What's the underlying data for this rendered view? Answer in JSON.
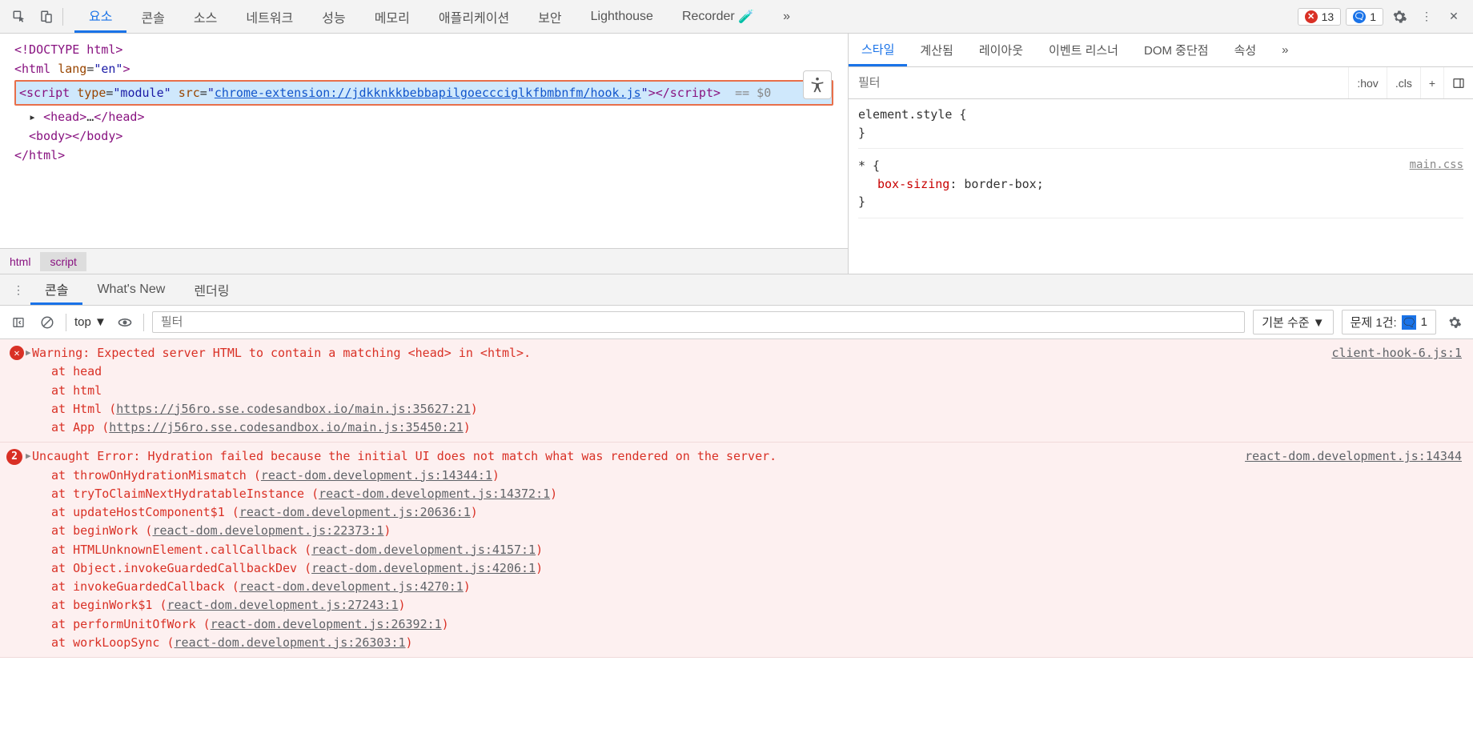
{
  "toolbar": {
    "tabs": [
      "요소",
      "콘솔",
      "소스",
      "네트워크",
      "성능",
      "메모리",
      "애플리케이션",
      "보안",
      "Lighthouse",
      "Recorder"
    ],
    "active_tab": 0,
    "recorder_flask": "⚗",
    "more": "»",
    "error_count": "13",
    "issue_count": "1"
  },
  "dom": {
    "line_doctype": "<!DOCTYPE html>",
    "line_html_open": "<html lang=\"en\">",
    "selected_prefix": "<script type=\"module\" src=\"",
    "selected_link": "chrome-extension://jdkknkkbebbapilgoeccciglkfbmbnfm/hook.js",
    "selected_suffix": "\"></script>",
    "dollar0": "== $0",
    "line_head": "<head>…</head>",
    "line_body": "<body></body>",
    "line_html_close": "</html>"
  },
  "breadcrumb": {
    "items": [
      "html",
      "script"
    ],
    "active": 1
  },
  "styles": {
    "tabs": [
      "스타일",
      "계산됨",
      "레이아웃",
      "이벤트 리스너",
      "DOM 중단점",
      "속성"
    ],
    "active_tab": 0,
    "more": "»",
    "filter_placeholder": "필터",
    "hov": ":hov",
    "cls": ".cls",
    "plus": "+",
    "rule0_selector": "element.style {",
    "rule0_close": "}",
    "rule1_selector": "* {",
    "rule1_prop": "box-sizing",
    "rule1_val": "border-box",
    "rule1_close": "}",
    "rule1_source": "main.css"
  },
  "drawer": {
    "tabs": [
      "콘솔",
      "What's New",
      "렌더링"
    ],
    "active_tab": 0
  },
  "console_toolbar": {
    "context": "top",
    "filter_placeholder": "필터",
    "level": "기본 수준",
    "issues_label": "문제 1건:",
    "issues_count": "1"
  },
  "console": {
    "msg1": {
      "text": "Warning: Expected server HTML to contain a matching <head> in <html>.",
      "source": "client-hook-6.js:1",
      "stack": [
        {
          "at": "at head",
          "link": ""
        },
        {
          "at": "at html",
          "link": ""
        },
        {
          "at": "at Html (",
          "link": "https://j56ro.sse.codesandbox.io/main.js:35627:21",
          "close": ")"
        },
        {
          "at": "at App (",
          "link": "https://j56ro.sse.codesandbox.io/main.js:35450:21",
          "close": ")"
        }
      ]
    },
    "msg2": {
      "count": "2",
      "text": "Uncaught Error: Hydration failed because the initial UI does not match what was rendered on the server.",
      "source": "react-dom.development.js:14344",
      "stack": [
        {
          "at": "at throwOnHydrationMismatch (",
          "link": "react-dom.development.js:14344:1",
          "close": ")"
        },
        {
          "at": "at tryToClaimNextHydratableInstance (",
          "link": "react-dom.development.js:14372:1",
          "close": ")"
        },
        {
          "at": "at updateHostComponent$1 (",
          "link": "react-dom.development.js:20636:1",
          "close": ")"
        },
        {
          "at": "at beginWork (",
          "link": "react-dom.development.js:22373:1",
          "close": ")"
        },
        {
          "at": "at HTMLUnknownElement.callCallback (",
          "link": "react-dom.development.js:4157:1",
          "close": ")"
        },
        {
          "at": "at Object.invokeGuardedCallbackDev (",
          "link": "react-dom.development.js:4206:1",
          "close": ")"
        },
        {
          "at": "at invokeGuardedCallback (",
          "link": "react-dom.development.js:4270:1",
          "close": ")"
        },
        {
          "at": "at beginWork$1 (",
          "link": "react-dom.development.js:27243:1",
          "close": ")"
        },
        {
          "at": "at performUnitOfWork (",
          "link": "react-dom.development.js:26392:1",
          "close": ")"
        },
        {
          "at": "at workLoopSync (",
          "link": "react-dom.development.js:26303:1",
          "close": ")"
        }
      ]
    }
  }
}
